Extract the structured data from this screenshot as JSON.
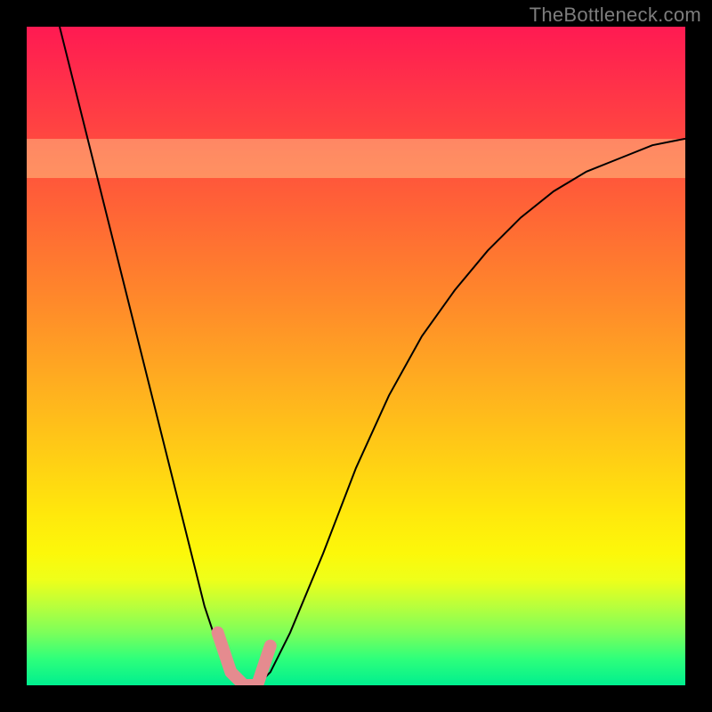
{
  "watermark": "TheBottleneck.com",
  "colors": {
    "background": "#000000",
    "curve": "#000000",
    "marker": "#e58b8f",
    "watermark": "#7d7d7d"
  },
  "chart_data": {
    "type": "line",
    "title": "",
    "xlabel": "",
    "ylabel": "",
    "xlim": [
      0,
      100
    ],
    "ylim": [
      0,
      100
    ],
    "plateau_band": {
      "y_from": 77,
      "y_to": 83
    },
    "series": [
      {
        "name": "bottleneck-curve",
        "x": [
          5,
          10,
          15,
          20,
          25,
          27,
          29,
          31,
          33,
          35,
          37,
          40,
          45,
          50,
          55,
          60,
          65,
          70,
          75,
          80,
          85,
          90,
          95,
          100
        ],
        "y": [
          100,
          80,
          60,
          40,
          20,
          12,
          6,
          2,
          0,
          0,
          2,
          8,
          20,
          33,
          44,
          53,
          60,
          66,
          71,
          75,
          78,
          80,
          82,
          83
        ]
      }
    ],
    "optimal_marker": {
      "x": [
        29,
        31,
        33,
        35,
        37
      ],
      "y": [
        8,
        2,
        0,
        0,
        6
      ]
    }
  }
}
